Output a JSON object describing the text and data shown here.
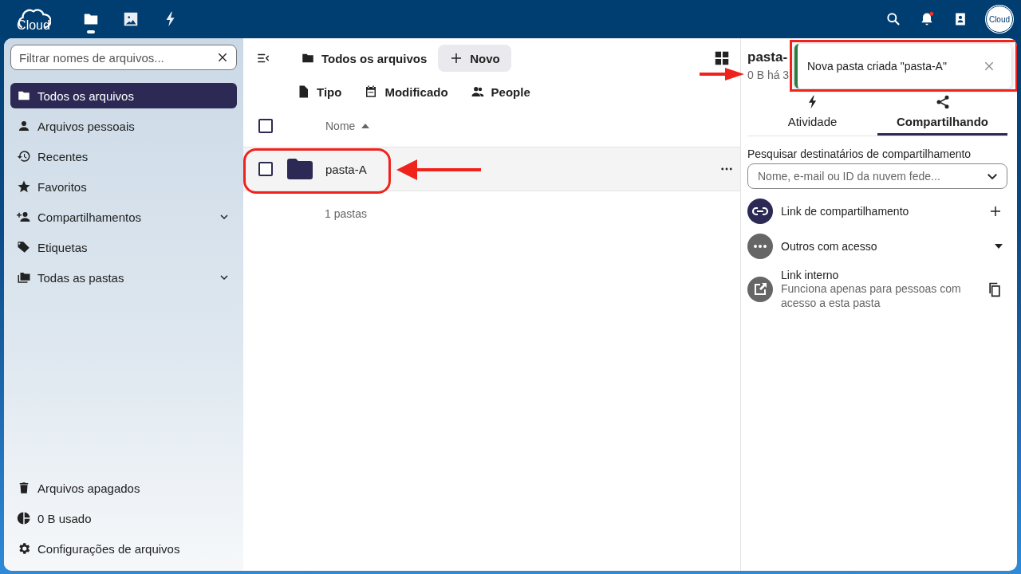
{
  "topbar": {
    "logo": "Cloud",
    "apps": [
      {
        "kind": "files",
        "selected": true
      },
      {
        "kind": "photos",
        "selected": false
      },
      {
        "kind": "activity",
        "selected": false
      }
    ],
    "avatar": "Cloud",
    "notification_unread": true
  },
  "navigation": {
    "filter_placeholder": "Filtrar nomes de arquivos...",
    "items": [
      {
        "label": "Todos os arquivos",
        "selected": true,
        "expandable": false
      },
      {
        "label": "Arquivos pessoais",
        "selected": false,
        "expandable": false
      },
      {
        "label": "Recentes",
        "selected": false,
        "expandable": false
      },
      {
        "label": "Favoritos",
        "selected": false,
        "expandable": false
      },
      {
        "label": "Compartilhamentos",
        "selected": false,
        "expandable": true
      },
      {
        "label": "Etiquetas",
        "selected": false,
        "expandable": false
      },
      {
        "label": "Todas as pastas",
        "selected": false,
        "expandable": true
      }
    ],
    "footer": [
      {
        "label": "Arquivos apagados"
      },
      {
        "label": "0 B usado"
      },
      {
        "label": "Configurações de arquivos"
      }
    ]
  },
  "files": {
    "breadcrumb": "Todos os arquivos",
    "new_button": "Novo",
    "filters": [
      {
        "label": "Tipo"
      },
      {
        "label": "Modificado"
      },
      {
        "label": "People"
      }
    ],
    "all_selected": false,
    "columns": [
      {
        "label": "Nome"
      }
    ],
    "rows": [
      {
        "name": "pasta-A",
        "kind": "folder",
        "selected": false
      }
    ],
    "summary": "1 pastas"
  },
  "details": {
    "title": "pasta-",
    "subtitle": "0 B há 3",
    "tabs": [
      {
        "label": "Atividade",
        "selected": false
      },
      {
        "label": "Compartilhando",
        "selected": true
      }
    ],
    "search_label": "Pesquisar destinatários de compartilhamento",
    "search_placeholder": "Nome, e-mail ou ID da nuvem fede...",
    "entries": [
      {
        "kind": "link",
        "title": "Link de compartilhamento"
      },
      {
        "kind": "others",
        "title": "Outros com acesso"
      },
      {
        "kind": "internal",
        "title": "Link interno",
        "subtitle": "Funciona apenas para pessoas com acesso a esta pasta"
      }
    ]
  },
  "toast": {
    "message": "Nova pasta criada \"pasta-A\""
  }
}
